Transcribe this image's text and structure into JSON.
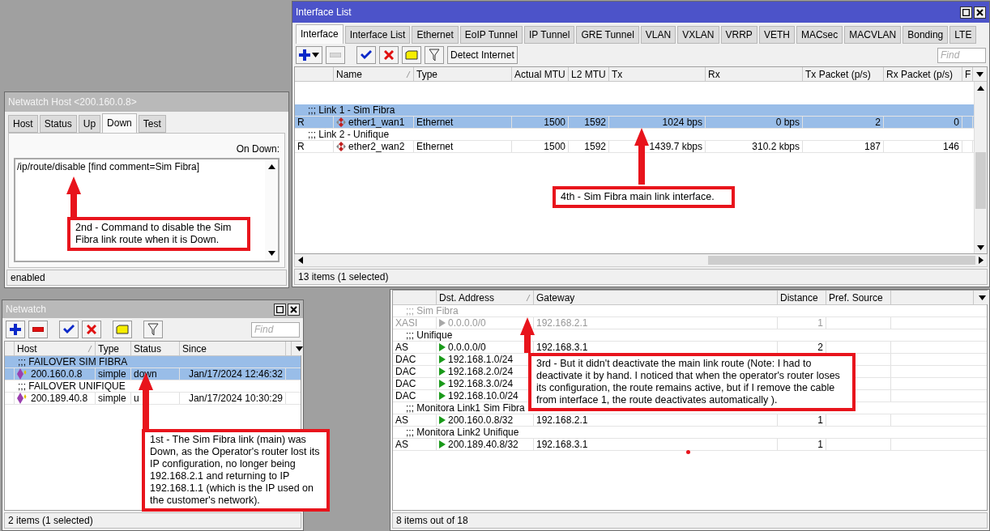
{
  "interface_list": {
    "title": "Interface List",
    "tabs": [
      {
        "label": "Interface",
        "selected": true
      },
      {
        "label": "Interface List",
        "selected": false
      },
      {
        "label": "Ethernet",
        "selected": false
      },
      {
        "label": "EoIP Tunnel",
        "selected": false
      },
      {
        "label": "IP Tunnel",
        "selected": false
      },
      {
        "label": "GRE Tunnel",
        "selected": false
      },
      {
        "label": "VLAN",
        "selected": false
      },
      {
        "label": "VXLAN",
        "selected": false
      },
      {
        "label": "VRRP",
        "selected": false
      },
      {
        "label": "VETH",
        "selected": false
      },
      {
        "label": "MACsec",
        "selected": false
      },
      {
        "label": "MACVLAN",
        "selected": false
      },
      {
        "label": "Bonding",
        "selected": false
      },
      {
        "label": "LTE",
        "selected": false
      }
    ],
    "toolbar": {
      "remove_disabled": true,
      "detect_button": "Detect Internet",
      "find_placeholder": "Find"
    },
    "columns": [
      "Name",
      "Type",
      "Actual MTU",
      "L2 MTU",
      "Tx",
      "Rx",
      "Tx Packet (p/s)",
      "Rx Packet (p/s)",
      "F"
    ],
    "rows": [
      {
        "kind": "comment",
        "text": ";;; Link 1 - Sim Fibra",
        "selected": true
      },
      {
        "kind": "item",
        "flag": "R",
        "cells": [
          "ether1_wan1",
          "Ethernet",
          "1500",
          "1592",
          "1024 bps",
          "0 bps",
          "2",
          "0"
        ],
        "selected": true
      },
      {
        "kind": "comment",
        "text": ";;; Link 2 - Unifique",
        "selected": false
      },
      {
        "kind": "item",
        "flag": "R",
        "cells": [
          "ether2_wan2",
          "Ethernet",
          "1500",
          "1592",
          "1439.7 kbps",
          "310.2 kbps",
          "187",
          "146"
        ],
        "selected": false
      }
    ],
    "status": "13 items (1 selected)"
  },
  "netwatch_host": {
    "title": "Netwatch Host <200.160.0.8>",
    "tabs": [
      {
        "label": "Host",
        "selected": false
      },
      {
        "label": "Status",
        "selected": false
      },
      {
        "label": "Up",
        "selected": false
      },
      {
        "label": "Down",
        "selected": true
      },
      {
        "label": "Test",
        "selected": false
      }
    ],
    "field_label": "On Down:",
    "script": "/ip/route/disable [find comment=Sim Fibra]",
    "status": "enabled"
  },
  "netwatch": {
    "title": "Netwatch",
    "toolbar": {
      "remove_disabled": false,
      "find_placeholder": "Find"
    },
    "columns": [
      "Host",
      "Type",
      "Status",
      "Since"
    ],
    "rows": [
      {
        "kind": "comment",
        "text": ";;; FAILOVER SIM FIBRA",
        "selected": true
      },
      {
        "kind": "item",
        "cells": [
          "200.160.0.8",
          "simple",
          "down",
          "Jan/17/2024 12:46:32"
        ],
        "selected": true
      },
      {
        "kind": "comment",
        "text": ";;; FAILOVER UNIFIQUE",
        "selected": false
      },
      {
        "kind": "item",
        "cells": [
          "200.189.40.8",
          "simple",
          "u",
          "Jan/17/2024 10:30:29"
        ],
        "selected": false
      }
    ],
    "status": "2 items (1 selected)"
  },
  "routes": {
    "columns": [
      "Dst. Address",
      "Gateway",
      "Distance",
      "Pref. Source"
    ],
    "rows": [
      {
        "kind": "comment",
        "text": ";;; Sim Fibra",
        "disabled": true
      },
      {
        "kind": "item",
        "flag": "XASI",
        "cells": [
          "0.0.0.0/0",
          "192.168.2.1",
          "1"
        ],
        "disabled": true
      },
      {
        "kind": "comment",
        "text": ";;; Unifique",
        "disabled": false
      },
      {
        "kind": "item",
        "flag": "AS",
        "cells": [
          "0.0.0.0/0",
          "192.168.3.1",
          "2"
        ],
        "disabled": false
      },
      {
        "kind": "item",
        "flag": "DAC",
        "cells": [
          "192.168.1.0/24"
        ],
        "disabled": false
      },
      {
        "kind": "item",
        "flag": "DAC",
        "cells": [
          "192.168.2.0/24"
        ],
        "disabled": false
      },
      {
        "kind": "item",
        "flag": "DAC",
        "cells": [
          "192.168.3.0/24"
        ],
        "disabled": false
      },
      {
        "kind": "item",
        "flag": "DAC",
        "cells": [
          "192.168.10.0/24"
        ],
        "disabled": false
      },
      {
        "kind": "comment",
        "text": ";;; Monitora Link1 Sim Fibra",
        "disabled": false
      },
      {
        "kind": "item",
        "flag": "AS",
        "cells": [
          "200.160.0.8/32",
          "192.168.2.1",
          "1"
        ],
        "disabled": false
      },
      {
        "kind": "comment",
        "text": ";;; Monitora Link2 Unifique",
        "disabled": false
      },
      {
        "kind": "item",
        "flag": "AS",
        "cells": [
          "200.189.40.8/32",
          "192.168.3.1",
          "1"
        ],
        "disabled": false
      }
    ],
    "status": "8 items out of 18"
  },
  "annotations": [
    {
      "text": "4th - Sim Fibra main link interface."
    },
    {
      "text": "2nd - Command to disable the Sim Fibra link route when it is Down."
    },
    {
      "text": "3rd - But it didn't deactivate the main link route (Note: I had to deactivate it by hand. I noticed that when the operator's router loses its configuration, the route remains active, but if I remove the cable from interface 1, the route deactivates automatically )."
    },
    {
      "text": "1st - The Sim Fibra link (main) was Down, as the Operator's router lost its IP configuration, no longer being 192.168.2.1 and returning to IP 192.168.1.1 (which is the IP used on the customer's network)."
    }
  ]
}
